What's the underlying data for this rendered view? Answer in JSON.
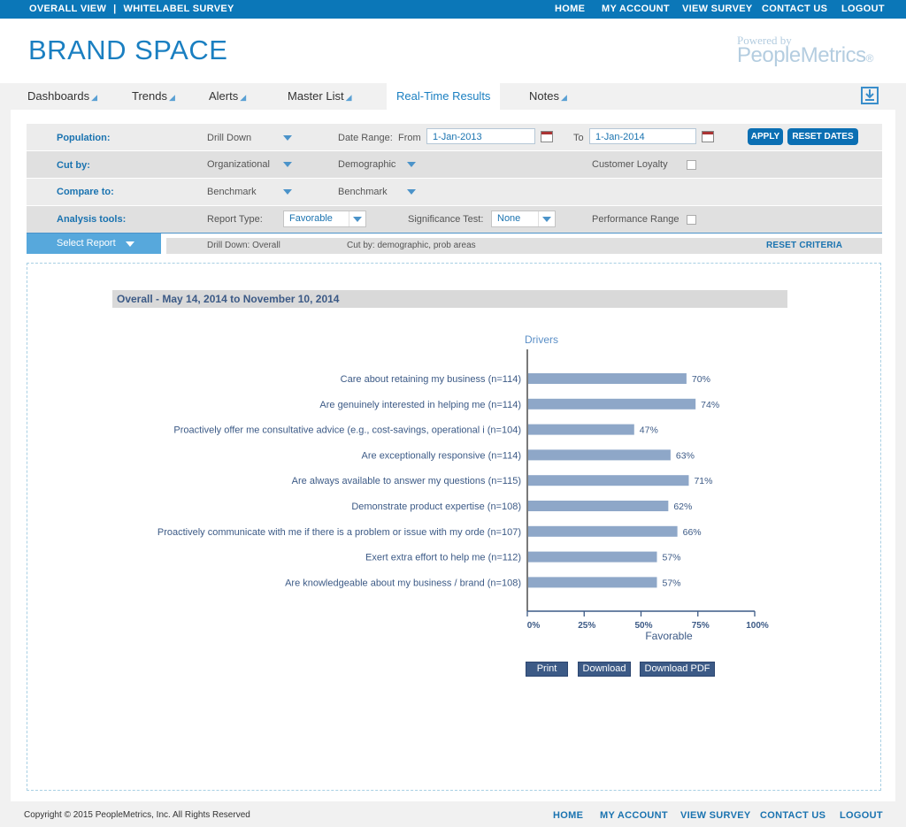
{
  "topbar": {
    "overall_view": "OVERALL VIEW",
    "separator": "|",
    "survey_name": "WHITELABEL SURVEY",
    "nav": [
      "HOME",
      "MY ACCOUNT",
      "VIEW SURVEY",
      "CONTACT US",
      "LOGOUT"
    ]
  },
  "header": {
    "brand": "BRAND SPACE",
    "powered_by": "Powered by",
    "company": "PeopleMetrics",
    "trademark": "®"
  },
  "tabs": [
    {
      "label": "Dashboards"
    },
    {
      "label": "Trends"
    },
    {
      "label": "Alerts"
    },
    {
      "label": "Master List"
    },
    {
      "label": "Real-Time Results",
      "active": true
    },
    {
      "label": "Notes"
    }
  ],
  "filters": {
    "population": {
      "label": "Population:",
      "dropdown": "Drill Down"
    },
    "date_range": {
      "label": "Date Range:",
      "from_label": "From",
      "from_value": "1-Jan-2013",
      "to_label": "To",
      "to_value": "1-Jan-2014"
    },
    "apply": "APPLY",
    "reset_dates": "RESET DATES",
    "cut_by": {
      "label": "Cut by:",
      "dropdown1": "Organizational",
      "dropdown2": "Demographic",
      "checkbox_label": "Customer Loyalty"
    },
    "compare_to": {
      "label": "Compare to:",
      "dropdown1": "Benchmark",
      "dropdown2": "Benchmark"
    },
    "analysis_tools": {
      "label": "Analysis tools:",
      "report_type_label": "Report Type:",
      "report_type_value": "Favorable",
      "significance_label": "Significance Test:",
      "significance_value": "None",
      "performance_label": "Performance Range"
    }
  },
  "select_report": "Select Report",
  "criteria": {
    "drill_down": "Drill Down: Overall",
    "cut_by": "Cut by: demographic, prob areas",
    "reset": "RESET CRITERIA"
  },
  "report": {
    "title": "Overall  - May 14, 2014 to November 10, 2014",
    "buttons": {
      "print": "Print",
      "download": "Download",
      "download_pdf": "Download PDF"
    }
  },
  "chart_data": {
    "type": "bar",
    "orientation": "horizontal",
    "title": "Drivers",
    "xlabel": "Favorable",
    "xlim": [
      0,
      100
    ],
    "x_ticks": [
      "0%",
      "25%",
      "50%",
      "75%",
      "100%"
    ],
    "categories": [
      "Care about retaining my business (n=114)",
      "Are genuinely interested in helping me (n=114)",
      "Proactively offer me consultative advice (e.g., cost-savings, operational i (n=104)",
      "Are exceptionally responsive (n=114)",
      "Are always available to answer my questions (n=115)",
      "Demonstrate product expertise (n=108)",
      "Proactively communicate with me if there is a problem or issue with my orde (n=107)",
      "Exert extra effort to help me (n=112)",
      "Are knowledgeable about my business / brand (n=108)"
    ],
    "values": [
      70,
      74,
      47,
      63,
      71,
      62,
      66,
      57,
      57
    ],
    "value_labels": [
      "70%",
      "74%",
      "47%",
      "63%",
      "71%",
      "62%",
      "66%",
      "57%",
      "57%"
    ],
    "bar_color": "#8ea7c8"
  },
  "footer": {
    "copyright": "Copyright © 2015 PeopleMetrics, Inc. All Rights Reserved",
    "nav": [
      "HOME",
      "MY ACCOUNT",
      "VIEW SURVEY",
      "CONTACT US",
      "LOGOUT"
    ]
  },
  "colors": {
    "primary": "#0b77b8",
    "brand": "#1a7fc1",
    "report_blue": "#3c5a86"
  }
}
